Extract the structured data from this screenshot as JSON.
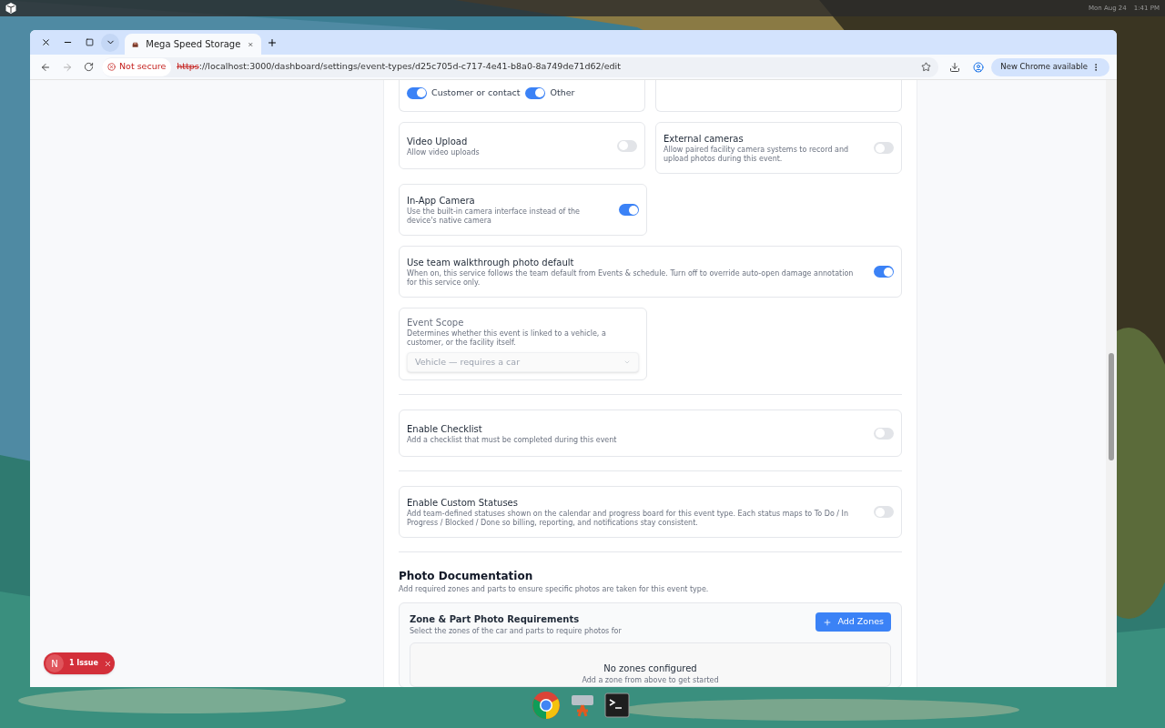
{
  "system_bar": {
    "date": "Mon Aug 24",
    "time": "1:41 PM"
  },
  "browser": {
    "tab_title": "Mega Speed Storage",
    "security": "Not secure",
    "url_scheme": "https",
    "url_rest": "://localhost:3000/dashboard/settings/event-types/d25c705d-c717-4e41-b8a0-8a749de71d62/edit",
    "update_button": "New Chrome available"
  },
  "linked_toggles": [
    {
      "label": "Customer or contact",
      "on": true
    },
    {
      "label": "Other",
      "on": true
    }
  ],
  "settings_pairs": [
    [
      {
        "title": "Video Upload",
        "description": "Allow video uploads",
        "on": false
      },
      {
        "title": "External cameras",
        "description": "Allow paired facility camera systems to record and upload photos during this event.",
        "on": false
      }
    ],
    [
      {
        "title": "In-App Camera",
        "description": "Use the built-in camera interface instead of the device's native camera",
        "on": true
      }
    ]
  ],
  "walkthrough": {
    "title": "Use team walkthrough photo default",
    "description": "When on, this service follows the team default from Events & schedule. Turn off to override auto-open damage annotation for this service only.",
    "on": true
  },
  "event_scope": {
    "title": "Event Scope",
    "description": "Determines whether this event is linked to a vehicle, a customer, or the facility itself.",
    "value": "Vehicle — requires a car",
    "disabled": true
  },
  "sections": [
    {
      "title": "Enable Checklist",
      "description": "Add a checklist that must be completed during this event",
      "on": false
    },
    {
      "title": "Enable Custom Statuses",
      "description": "Add team-defined statuses shown on the calendar and progress board for this event type. Each status maps to To Do / In Progress / Blocked / Done so billing, reporting, and notifications stay consistent.",
      "on": false
    }
  ],
  "photo_documentation": {
    "title": "Photo Documentation",
    "description": "Add required zones and parts to ensure specific photos are taken for this event type.",
    "card_title": "Zone & Part Photo Requirements",
    "card_description": "Select the zones of the car and parts to require photos for",
    "add_button": "Add Zones",
    "empty_title": "No zones configured",
    "empty_hint": "Add a zone from above to get started"
  },
  "issue_badge": {
    "letter": "N",
    "label": "1 Issue"
  }
}
